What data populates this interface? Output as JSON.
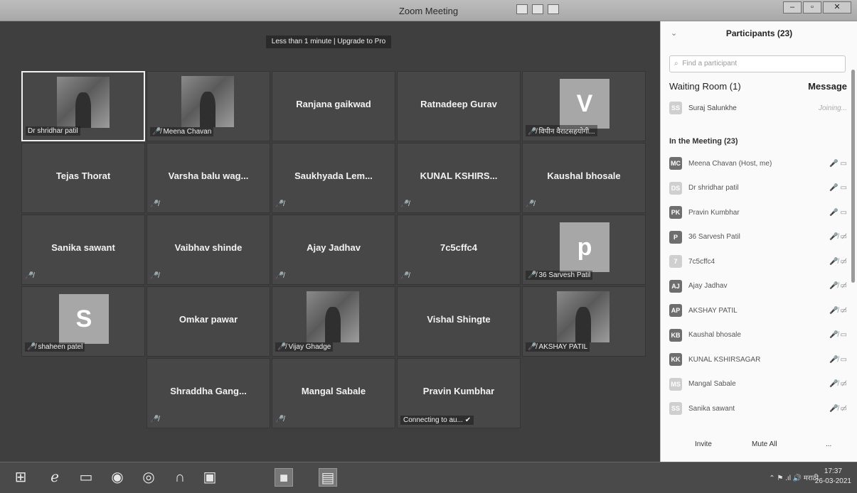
{
  "window": {
    "title": "Zoom Meeting",
    "minimize": "–",
    "maximize": "▫",
    "close": "✕"
  },
  "meeting": {
    "banner": "Less than 1 minute | Upgrade to Pro",
    "connecting": "Connecting to au... ✔",
    "tiles": [
      {
        "name": "Dr shridhar patil",
        "kind": "photo",
        "active": true
      },
      {
        "name": "Meena Chavan",
        "kind": "photo",
        "muted": true
      },
      {
        "name": "Ranjana gaikwad",
        "kind": "text"
      },
      {
        "name": "Ratnadeep Gurav",
        "kind": "text"
      },
      {
        "name": "विपीन वैराटसहयोगी...",
        "kind": "letter",
        "letter": "V",
        "muted": true
      },
      {
        "name": "Tejas Thorat",
        "kind": "text"
      },
      {
        "name": "Varsha balu wag...",
        "kind": "text",
        "muted": true
      },
      {
        "name": "Saukhyada Lem...",
        "kind": "text",
        "muted": true
      },
      {
        "name": "KUNAL KSHIRS...",
        "kind": "text",
        "muted": true
      },
      {
        "name": "Kaushal bhosale",
        "kind": "text",
        "muted": true
      },
      {
        "name": "Sanika sawant",
        "kind": "text",
        "muted": true
      },
      {
        "name": "Vaibhav shinde",
        "kind": "text",
        "muted": true
      },
      {
        "name": "Ajay Jadhav",
        "kind": "text",
        "muted": true
      },
      {
        "name": "7c5cffc4",
        "kind": "text",
        "muted": true
      },
      {
        "name": "36 Sarvesh Patil",
        "kind": "letter",
        "letter": "p",
        "muted": true
      },
      {
        "name": "shaheen patel",
        "kind": "letter",
        "letter": "S",
        "muted": true
      },
      {
        "name": "Omkar pawar",
        "kind": "text"
      },
      {
        "name": "Vijay Ghadge",
        "kind": "photo",
        "muted": true
      },
      {
        "name": "Vishal Shingte",
        "kind": "text"
      },
      {
        "name": "AKSHAY PATIL",
        "kind": "photo",
        "muted": true
      },
      {
        "name": "",
        "kind": "empty"
      },
      {
        "name": "Shraddha Gang...",
        "kind": "text",
        "muted": true
      },
      {
        "name": "Mangal Sabale",
        "kind": "text",
        "muted": true
      },
      {
        "name": "Pravin Kumbhar",
        "kind": "text",
        "connecting": true
      }
    ]
  },
  "participants": {
    "title": "Participants (23)",
    "search_placeholder": "Find a participant",
    "waiting_header": "Waiting Room (1)",
    "message_label": "Message",
    "waiting": [
      {
        "initials": "SS",
        "name": "Suraj Salunkhe",
        "status": "Joining..."
      }
    ],
    "in_meeting_header": "In the Meeting (23)",
    "list": [
      {
        "initials": "MC",
        "name": "Meena Chavan (Host, me)",
        "icons": "🎤 ▭"
      },
      {
        "initials": "DS",
        "name": "Dr shridhar patil",
        "icons": "🎤 ▭"
      },
      {
        "initials": "PK",
        "name": "Pravin Kumbhar",
        "icons": "🎤 ▭"
      },
      {
        "initials": "P",
        "name": "36 Sarvesh Patil",
        "icons": "🎤̸ ▭̸"
      },
      {
        "initials": "7",
        "name": "7c5cffc4",
        "icons": "🎤̸ ▭̸"
      },
      {
        "initials": "AJ",
        "name": "Ajay Jadhav",
        "icons": "🎤̸ ▭̸"
      },
      {
        "initials": "AP",
        "name": "AKSHAY PATIL",
        "icons": "🎤̸ ▭̸"
      },
      {
        "initials": "KB",
        "name": "Kaushal bhosale",
        "icons": "🎤̸ ▭"
      },
      {
        "initials": "KK",
        "name": "KUNAL KSHIRSAGAR",
        "icons": "🎤̸ ▭"
      },
      {
        "initials": "MS",
        "name": "Mangal Sabale",
        "icons": "🎤̸ ▭̸"
      },
      {
        "initials": "SS",
        "name": "Sanika sawant",
        "icons": "🎤̸ ▭̸"
      }
    ],
    "invite": "Invite",
    "mute_all": "Mute All",
    "more": "..."
  },
  "taskbar": {
    "tray": "⌃  ⚑  .ıl  🔊  मराठी",
    "time": "17:37",
    "date": "26-03-2021"
  }
}
